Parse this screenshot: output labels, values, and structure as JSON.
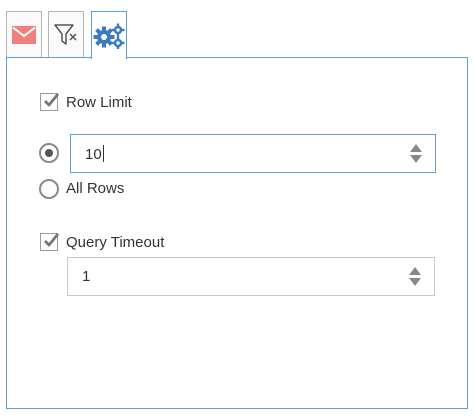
{
  "tabs": [
    {
      "icon": "mail-icon",
      "color": "#f08080",
      "active": false
    },
    {
      "icon": "filter-icon",
      "color": "#555555",
      "active": false
    },
    {
      "icon": "gears-icon",
      "color": "#3a7bbf",
      "active": true
    }
  ],
  "colors": {
    "accent": "#5a9fd4",
    "text": "#333333",
    "checkmark": "#777777"
  },
  "row_limit": {
    "label": "Row Limit",
    "checked": true,
    "value": "10",
    "limit_selected": true
  },
  "all_rows": {
    "label": "All Rows",
    "selected": false
  },
  "query_timeout": {
    "label": "Query Timeout",
    "checked": true,
    "value": "1"
  }
}
